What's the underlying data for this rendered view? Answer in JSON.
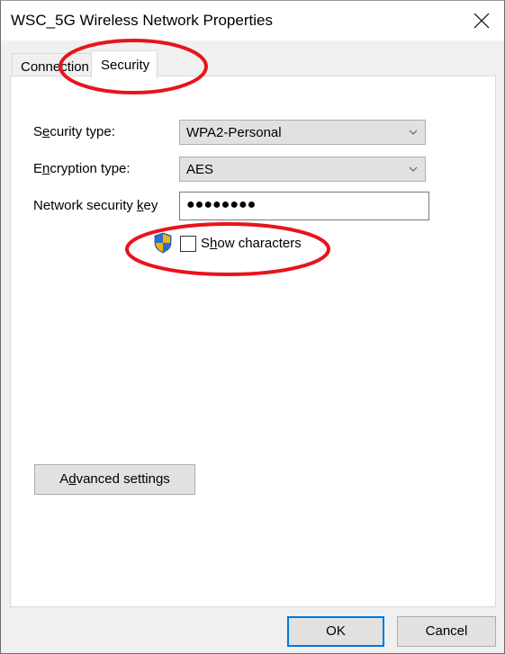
{
  "window": {
    "title": "WSC_5G Wireless Network Properties",
    "close_icon": "close-icon"
  },
  "tabs": [
    {
      "label": "Connection",
      "selected": false
    },
    {
      "label": "Security",
      "selected": true
    }
  ],
  "security": {
    "security_type": {
      "label_pre": "S",
      "label_accel": "e",
      "label_post": "curity type:",
      "value": "WPA2-Personal"
    },
    "encryption_type": {
      "label_pre": "E",
      "label_accel": "n",
      "label_post": "cryption type:",
      "value": "AES"
    },
    "network_key": {
      "label_pre": "Network security ",
      "label_accel": "k",
      "label_post": "ey",
      "value": "●●●●●●●●"
    },
    "show_characters": {
      "label_pre": "S",
      "label_accel": "h",
      "label_post": "ow characters",
      "checked": false,
      "icon": "uac-shield-icon"
    },
    "advanced": {
      "label_pre": "A",
      "label_accel": "d",
      "label_post": "vanced settings"
    }
  },
  "footer": {
    "ok_label": "OK",
    "cancel_label": "Cancel"
  },
  "annotations": {
    "color": "#e8141c",
    "circled": [
      "Security tab",
      "Show characters"
    ]
  }
}
